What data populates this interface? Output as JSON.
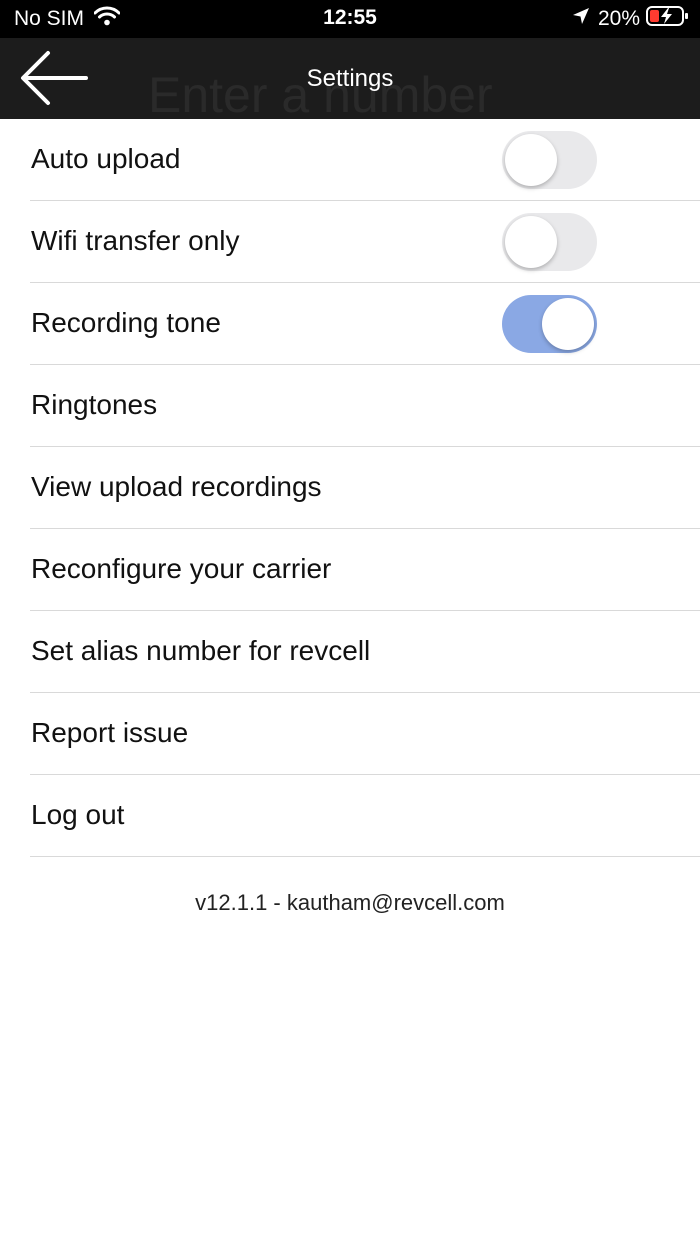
{
  "status_bar": {
    "carrier": "No SIM",
    "time": "12:55",
    "battery": "20%",
    "icons": [
      "wifi-icon",
      "location-arrow-icon",
      "battery-charging-icon"
    ]
  },
  "nav": {
    "title": "Settings",
    "ghost_text": "Enter a number",
    "back_icon": "arrow-left-icon"
  },
  "settings": {
    "auto_upload": {
      "label": "Auto upload",
      "enabled": false
    },
    "wifi_transfer_only": {
      "label": "Wifi transfer only",
      "enabled": false
    },
    "recording_tone": {
      "label": "Recording tone",
      "enabled": true
    },
    "ringtones": "Ringtones",
    "view_upload_recordings": "View upload recordings",
    "reconfigure_carrier": "Reconfigure your carrier",
    "set_alias_number": "Set alias number for revcell",
    "report_issue": "Report issue",
    "log_out": "Log out"
  },
  "footer": {
    "version_text": "v12.1.1 - kautham@revcell.com"
  },
  "colors": {
    "nav_background": "#1c1c1c",
    "toggle_on": "#8aa8e4",
    "toggle_off": "#e9e9eb",
    "battery_low": "#ff3b30"
  }
}
